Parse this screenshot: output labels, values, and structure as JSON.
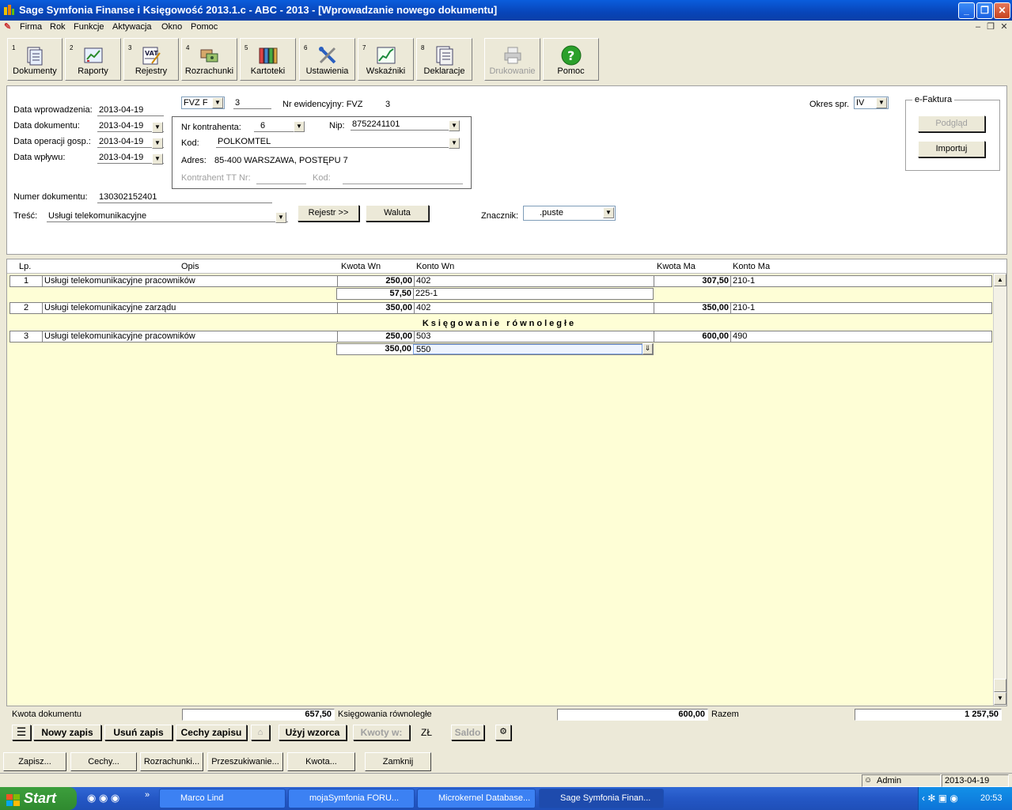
{
  "window": {
    "title": "Sage Symfonia Finanse i Księgowość 2013.1.c - ABC - 2013 - [Wprowadzanie nowego dokumentu]"
  },
  "menu": [
    "Firma",
    "Rok",
    "Funkcje",
    "Aktywacja",
    "Okno",
    "Pomoc"
  ],
  "toolbar": [
    {
      "num": "1",
      "label": "Dokumenty",
      "icon": "documents-icon"
    },
    {
      "num": "2",
      "label": "Raporty",
      "icon": "reports-icon"
    },
    {
      "num": "3",
      "label": "Rejestry",
      "icon": "vat-registers-icon"
    },
    {
      "num": "4",
      "label": "Rozrachunki",
      "icon": "settlements-icon"
    },
    {
      "num": "5",
      "label": "Kartoteki",
      "icon": "files-icon"
    },
    {
      "num": "6",
      "label": "Ustawienia",
      "icon": "tools-icon"
    },
    {
      "num": "7",
      "label": "Wskaźniki",
      "icon": "indicators-icon"
    },
    {
      "num": "8",
      "label": "Deklaracje",
      "icon": "declarations-icon"
    },
    {
      "num": "",
      "label": "Drukowanie",
      "icon": "printer-icon"
    },
    {
      "num": "",
      "label": "Pomoc",
      "icon": "help-icon"
    }
  ],
  "form": {
    "data_wprowadzenia_label": "Data wprowadzenia:",
    "data_wprowadzenia": "2013-04-19",
    "data_dokumentu_label": "Data dokumentu:",
    "data_dokumentu": "2013-04-19",
    "data_operacji_label": "Data operacji gosp.:",
    "data_operacji": "2013-04-19",
    "data_wplywu_label": "Data wpływu:",
    "data_wplywu": "2013-04-19",
    "typ": "FVZ  F",
    "numer": "3",
    "nr_ewidencyjny_label": "Nr ewidencyjny: FVZ",
    "nr_ewidencyjny": "3",
    "okres_label": "Okres spr.",
    "okres": "IV",
    "nr_kontrahenta_label": "Nr kontrahenta:",
    "nr_kontrahenta": "6",
    "nip_label": "Nip:",
    "nip": "8752241101",
    "kod_label": "Kod:",
    "kod": "POLKOMTEL",
    "adres_label": "Adres:",
    "adres": "85-400 WARSZAWA, POSTĘPU 7",
    "kontrahent_tt_label": "Kontrahent TT Nr:",
    "kontrahent_kod_label": "Kod:",
    "numer_dokumentu_label": "Numer dokumentu:",
    "numer_dokumentu": "130302152401",
    "tresc_label": "Treść:",
    "tresc": "Usługi telekomunikacyjne",
    "rejestr_btn": "Rejestr >>",
    "waluta_btn": "Waluta",
    "znacznik_label": "Znacznik:",
    "znacznik": ".puste",
    "efaktura_label": "e-Faktura",
    "podglad_btn": "Podgląd",
    "importuj_btn": "Importuj"
  },
  "grid": {
    "headers": {
      "lp": "Lp.",
      "opis": "Opis",
      "kwota_wn": "Kwota Wn",
      "konto_wn": "Konto Wn",
      "kwota_ma": "Kwota Ma",
      "konto_ma": "Konto Ma"
    },
    "rows": [
      {
        "lp": "1",
        "opis": "Usługi telekomunikacyjne pracowników",
        "kwota_wn": "250,00",
        "konto_wn": "402",
        "kwota_ma": "307,50",
        "konto_ma": "210-1"
      },
      {
        "kwota_wn": "57,50",
        "konto_wn": "225-1"
      },
      {
        "lp": "2",
        "opis": "Usługi telekomunikacyjne zarządu",
        "kwota_wn": "350,00",
        "konto_wn": "402",
        "kwota_ma": "350,00",
        "konto_ma": "210-1"
      },
      {
        "lp": "3",
        "opis": "Usługi telekomunikacyjne pracowników",
        "kwota_wn": "250,00",
        "konto_wn": "503",
        "kwota_ma": "600,00",
        "konto_ma": "490"
      },
      {
        "kwota_wn": "350,00",
        "konto_wn": "550"
      }
    ],
    "parallel_label": "Księgowanie równoległe"
  },
  "totals": {
    "kwota_dokumentu_label": "Kwota dokumentu",
    "kwota_dokumentu": "657,50",
    "ksiegowania_label": "Księgowania równoległe",
    "ksiegowania": "600,00",
    "razem_label": "Razem",
    "razem": "1 257,50"
  },
  "actions": {
    "nowy_zapis": "Nowy zapis",
    "usun_zapis": "Usuń zapis",
    "cechy_zapisu": "Cechy zapisu",
    "uzyj_wzorca": "Użyj wzorca",
    "kwoty_w": "Kwoty w:",
    "waluta": "ZŁ",
    "saldo": "Saldo"
  },
  "bottom_buttons": [
    "Zapisz...",
    "Cechy...",
    "Rozrachunki...",
    "Przeszukiwanie...",
    "Kwota...",
    "Zamknij"
  ],
  "status": {
    "user": "Admin",
    "date": "2013-04-19"
  },
  "taskbar": {
    "start": "Start",
    "tasks": [
      "Marco Lind",
      "mojaSymfonia FORU...",
      "Microkernel Database...",
      "Sage Symfonia Finan..."
    ],
    "clock": "20:53"
  }
}
